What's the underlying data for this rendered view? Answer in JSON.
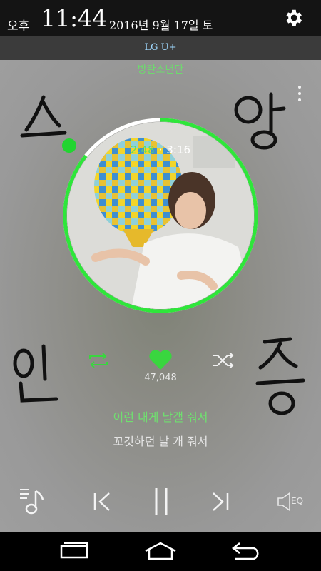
{
  "status": {
    "ampm": "오후",
    "time": "11:44",
    "date": "2016년 9월 17일 토",
    "carrier": "LG U+"
  },
  "player": {
    "artist": "방탄소년단",
    "elapsed": "2:48",
    "separator": "·",
    "duration": "3:16",
    "progress": 0.857,
    "like_count": "47,048",
    "lyric_current": "이런 내게 날갤 줘서",
    "lyric_next": "꼬깃하던 날 개 줘서",
    "accent_color": "#2ee63a"
  },
  "icons": {
    "settings": "gear-icon",
    "more": "more-vert-icon",
    "repeat": "repeat-icon",
    "like": "heart-icon",
    "shuffle": "shuffle-icon",
    "playlist": "playlist-icon",
    "previous": "skip-previous-icon",
    "pause": "pause-icon",
    "next": "skip-next-icon",
    "eq": "equalizer-icon",
    "recents": "recents-icon",
    "home": "home-icon",
    "back": "back-icon"
  },
  "eq_label": "EQ"
}
